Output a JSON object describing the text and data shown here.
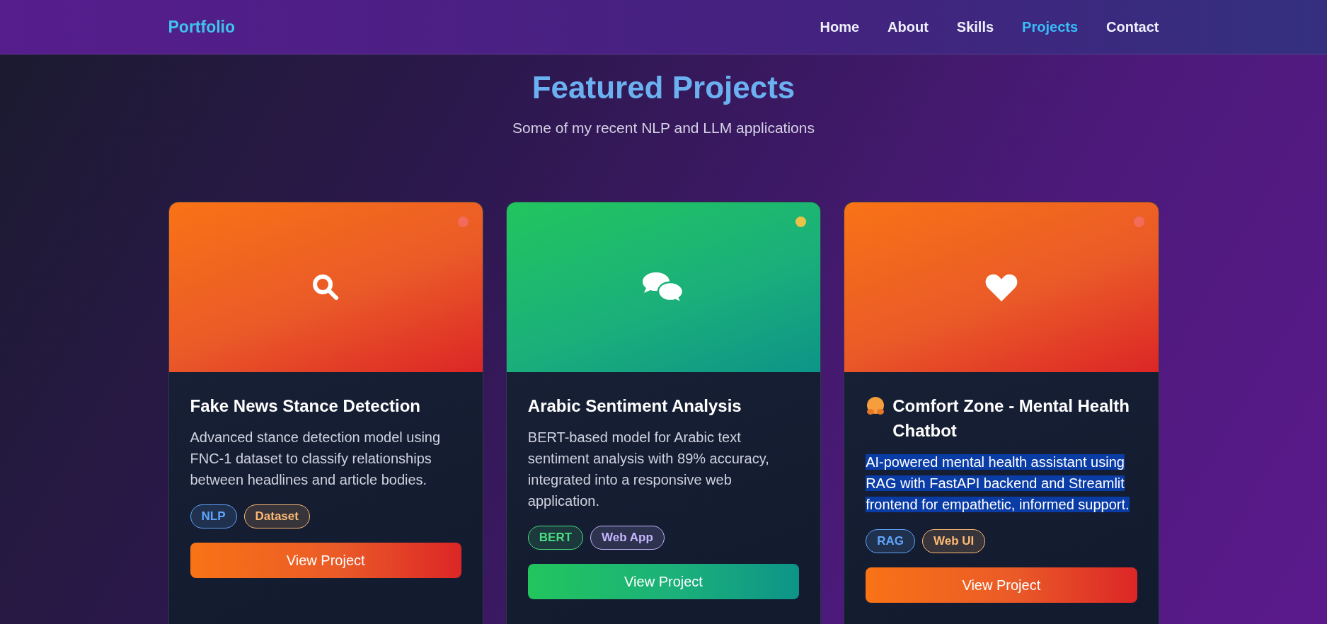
{
  "navbar": {
    "logo": "Portfolio",
    "links": [
      {
        "label": "Home",
        "selected": false
      },
      {
        "label": "About",
        "selected": false
      },
      {
        "label": "Skills",
        "selected": false
      },
      {
        "label": "Projects",
        "selected": true
      },
      {
        "label": "Contact",
        "selected": false
      }
    ]
  },
  "section": {
    "title": "Featured Projects",
    "subtitle": "Some of my recent NLP and LLM applications"
  },
  "projects": [
    {
      "kind": "search",
      "status": {
        "color": "#f26b5b"
      },
      "emoji": false,
      "title": "Fake News Stance Detection",
      "description": "Advanced stance detection model using FNC-1 dataset to classify relationships between headlines and article bodies.",
      "description_highlighted": false,
      "tags": [
        {
          "label": "NLP",
          "color": "#60a5fa"
        },
        {
          "label": "Dataset",
          "color": "#fdba74"
        }
      ],
      "button": "View Project"
    },
    {
      "kind": "chat",
      "status": {
        "color": "#eac247"
      },
      "emoji": false,
      "title": "Arabic Sentiment Analysis",
      "description": "BERT-based model for Arabic text sentiment analysis with 89% accuracy, integrated into a responsive web application.",
      "description_highlighted": false,
      "tags": [
        {
          "label": "BERT",
          "color": "#4ade80"
        },
        {
          "label": "Web App",
          "color": "#c4b5fd"
        }
      ],
      "button": "View Project"
    },
    {
      "kind": "heart",
      "status": {
        "color": "#f26b5b"
      },
      "emoji": true,
      "title": "Comfort Zone - Mental Health Chatbot",
      "description": "AI-powered mental health assistant using RAG with FastAPI backend and Streamlit frontend for empathetic, informed support.",
      "description_highlighted": true,
      "tags": [
        {
          "label": "RAG",
          "color": "#60a5fa"
        },
        {
          "label": "Web UI",
          "color": "#fdba74"
        }
      ],
      "button": "View Project"
    }
  ]
}
